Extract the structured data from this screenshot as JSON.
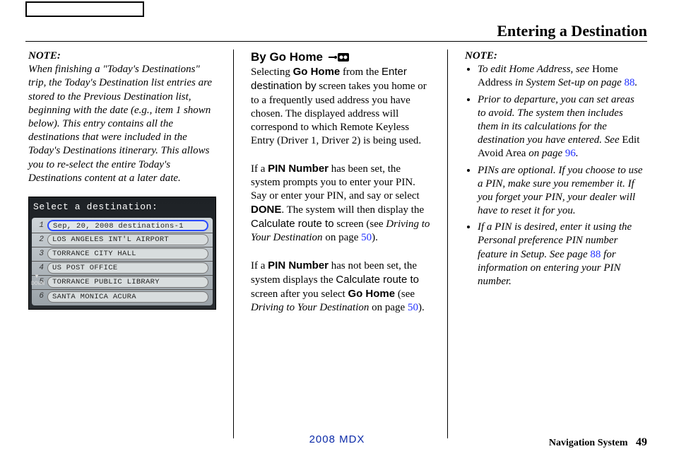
{
  "pageTitle": "Entering a Destination",
  "col1": {
    "noteHead": "NOTE:",
    "noteBody": "When finishing a \"Today's Destinations\" trip, the Today's Destination list entries are stored to the Previous Destination list, beginning with the date (e.g., item 1 shown below). This entry contains all the destinations that were included in the Today's Destinations itinerary. This allows you to re-select the entire Today's Destinations content at a later date."
  },
  "navShot": {
    "title": "Select a destination:",
    "rows": [
      {
        "num": "1",
        "label": "Sep, 20, 2008 destinations-1",
        "selected": true
      },
      {
        "num": "2",
        "label": "LOS ANGELES INT'L AIRPORT",
        "selected": false
      },
      {
        "num": "3",
        "label": "TORRANCE CITY HALL",
        "selected": false
      },
      {
        "num": "4",
        "label": "US POST OFFICE",
        "selected": false
      },
      {
        "num": "5",
        "label": "TORRANCE PUBLIC LIBRARY",
        "selected": false
      },
      {
        "num": "6",
        "label": "SANTA MONICA ACURA",
        "selected": false
      }
    ],
    "downLabel": "DOWN"
  },
  "col2": {
    "heading": "By Go Home",
    "p1_pre": "Selecting ",
    "p1_b1": "Go Home",
    "p1_mid1": " from the ",
    "p1_sans1": "Enter destination by",
    "p1_tail": " screen takes you home or to a frequently used address you have chosen. The displayed address will correspond to which Remote Keyless Entry (Driver 1, Driver 2) is being used.",
    "p2_a": "If a ",
    "p2_b1": "PIN Number",
    "p2_c": " has been set, the system prompts you to enter your PIN. Say or enter your PIN, and say or select ",
    "p2_b2": "DONE",
    "p2_d": ". The system will then display the ",
    "p2_sans": "Calculate route to",
    "p2_e": " screen (see ",
    "p2_it": "Driving to Your Destination",
    "p2_f": " on page ",
    "p2_pg": "50",
    "p2_g": ").",
    "p3_a": "If a ",
    "p3_b1": "PIN Number",
    "p3_c": " has not been set, the system displays the ",
    "p3_sans": "Calculate route to",
    "p3_d": " screen after you select ",
    "p3_b2": "Go Home",
    "p3_e": " (see ",
    "p3_it": "Driving to Your Destination",
    "p3_f": " on page ",
    "p3_pg": "50",
    "p3_g": ")."
  },
  "col3": {
    "noteHead": "NOTE:",
    "li1_a": "To edit Home Address, see ",
    "li1_b": "Home Address",
    "li1_c": " in System Set-up on page ",
    "li1_pg": "88",
    "li1_d": ".",
    "li2_a": "Prior to departure, you can set areas to avoid. The system then includes them in its calculations for the destination you have entered. See ",
    "li2_b": "Edit Avoid Area",
    "li2_c": " on page ",
    "li2_pg": "96",
    "li2_d": ".",
    "li3": "PINs are optional. If you choose to use a PIN, make sure you remember it. If you forget your PIN, your dealer will have to reset it for you.",
    "li4_a": "If a PIN is desired, enter it using the Personal preference PIN number feature in Setup. See page ",
    "li4_pg": "88",
    "li4_b": " for information on entering your PIN number."
  },
  "footer": {
    "center": "2008  MDX",
    "rightLabel": "Navigation System",
    "pageNum": "49"
  }
}
